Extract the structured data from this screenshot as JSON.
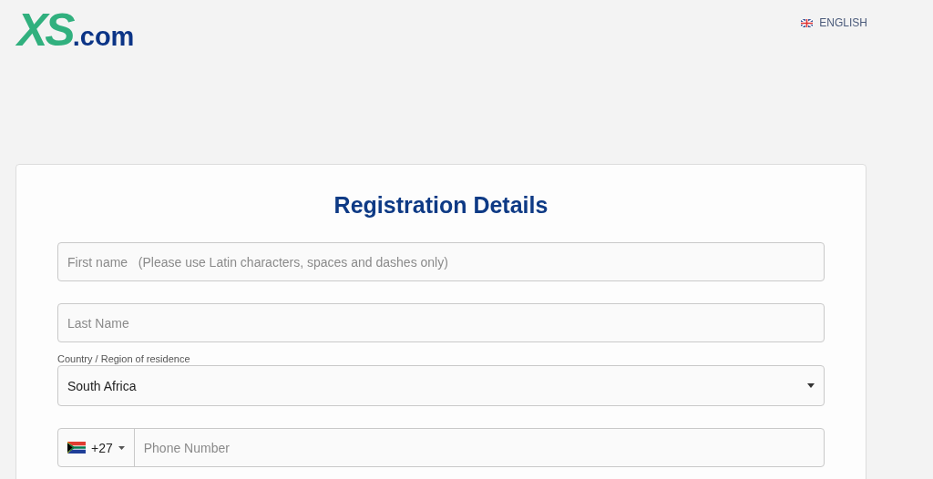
{
  "logo": {
    "mark": "XS",
    "suffix": ".com"
  },
  "language": {
    "label": "ENGLISH"
  },
  "form": {
    "title": "Registration Details",
    "first_name": {
      "placeholder": "First name   (Please use Latin characters, spaces and dashes only)"
    },
    "last_name": {
      "placeholder": "Last Name"
    },
    "country": {
      "label": "Country / Region of residence",
      "value": "South Africa"
    },
    "phone": {
      "code": "+27",
      "placeholder": "Phone Number"
    }
  }
}
